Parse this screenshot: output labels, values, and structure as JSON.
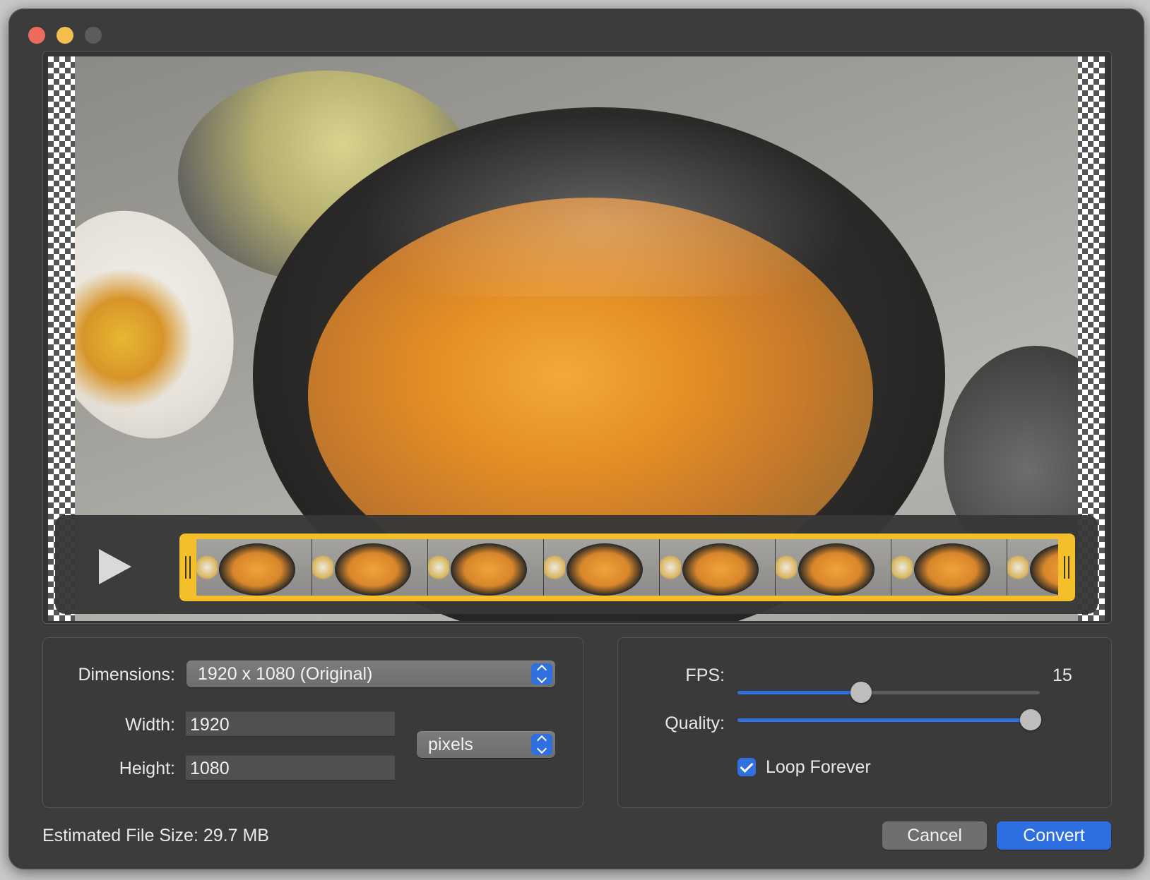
{
  "preview": {
    "filmstrip_frame_count": 8,
    "trim_handles": [
      "left",
      "right"
    ]
  },
  "dimensions": {
    "label": "Dimensions:",
    "selected": "1920 x 1080 (Original)"
  },
  "width": {
    "label": "Width:",
    "value": "1920"
  },
  "height": {
    "label": "Height:",
    "value": "1080"
  },
  "units": {
    "selected": "pixels"
  },
  "fps": {
    "label": "FPS:",
    "value": "15",
    "slider_fraction": 0.41
  },
  "quality": {
    "label": "Quality:",
    "slider_fraction": 0.97
  },
  "loop": {
    "label": "Loop Forever",
    "checked": true
  },
  "footer": {
    "estimated_size": "Estimated File Size: 29.7 MB",
    "cancel_label": "Cancel",
    "convert_label": "Convert"
  },
  "colors": {
    "accent": "#2f6fe0",
    "trim_border": "#f4bf2a",
    "close": "#ed6a5e",
    "minimize": "#f5bf4f"
  }
}
